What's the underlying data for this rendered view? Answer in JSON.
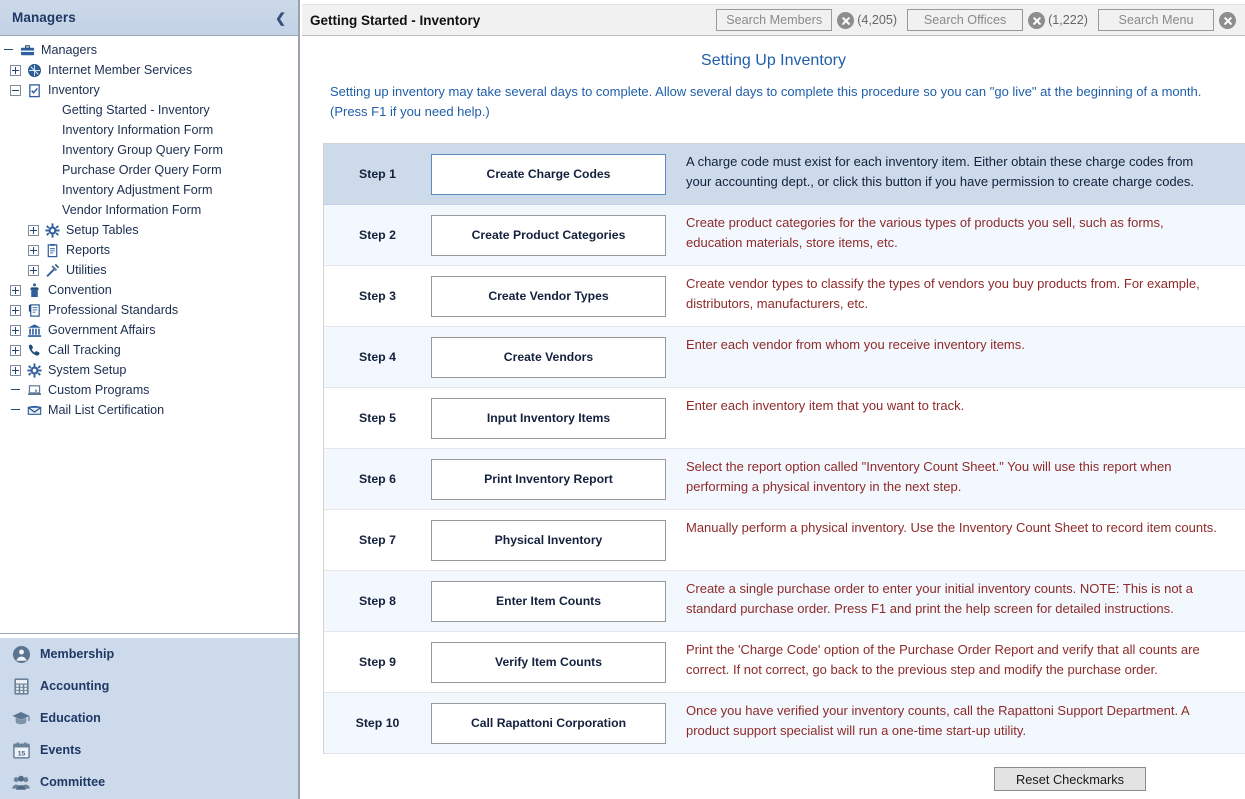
{
  "sidebar": {
    "header_title": "Managers",
    "collapse_icon": "chevron-left-icon",
    "tree": [
      {
        "label": "Managers",
        "icon": "briefcase-icon",
        "level": 0,
        "expander": "none"
      },
      {
        "label": "Internet Member Services",
        "icon": "globe-network-icon",
        "level": 1,
        "expander": "plus"
      },
      {
        "label": "Inventory",
        "icon": "clipboard-check-icon",
        "level": 1,
        "expander": "minus"
      },
      {
        "label": "Getting Started - Inventory",
        "icon": "",
        "level": 3,
        "expander": "none"
      },
      {
        "label": "Inventory Information Form",
        "icon": "",
        "level": 3,
        "expander": "none"
      },
      {
        "label": "Inventory Group Query Form",
        "icon": "",
        "level": 3,
        "expander": "none"
      },
      {
        "label": "Purchase Order Query Form",
        "icon": "",
        "level": 3,
        "expander": "none"
      },
      {
        "label": "Inventory Adjustment Form",
        "icon": "",
        "level": 3,
        "expander": "none"
      },
      {
        "label": "Vendor Information Form",
        "icon": "",
        "level": 3,
        "expander": "none"
      },
      {
        "label": "Setup Tables",
        "icon": "gear-icon",
        "level": 2,
        "expander": "plus"
      },
      {
        "label": "Reports",
        "icon": "report-clipboard-icon",
        "level": 2,
        "expander": "plus"
      },
      {
        "label": "Utilities",
        "icon": "tools-icon",
        "level": 2,
        "expander": "plus"
      },
      {
        "label": "Convention",
        "icon": "podium-icon",
        "level": 1,
        "expander": "plus"
      },
      {
        "label": "Professional Standards",
        "icon": "certificate-icon",
        "level": 1,
        "expander": "plus"
      },
      {
        "label": "Government Affairs",
        "icon": "bank-icon",
        "level": 1,
        "expander": "plus"
      },
      {
        "label": "Call Tracking",
        "icon": "phone-icon",
        "level": 1,
        "expander": "plus"
      },
      {
        "label": "System Setup",
        "icon": "gear-icon",
        "level": 1,
        "expander": "plus"
      },
      {
        "label": "Custom Programs",
        "icon": "laptop-icon",
        "level": 1,
        "expander": "none"
      },
      {
        "label": "Mail List Certification",
        "icon": "envelope-icon",
        "level": 1,
        "expander": "none"
      }
    ],
    "nav_items": [
      {
        "label": "Membership",
        "icon": "person-circle-icon"
      },
      {
        "label": "Accounting",
        "icon": "calculator-icon"
      },
      {
        "label": "Education",
        "icon": "graduation-cap-icon"
      },
      {
        "label": "Events",
        "icon": "calendar-icon"
      },
      {
        "label": "Committee",
        "icon": "people-group-icon"
      }
    ]
  },
  "topbar": {
    "page_title": "Getting Started - Inventory",
    "searches": [
      {
        "placeholder": "Search Members",
        "value": "",
        "count": "(4,205)",
        "clear_icon": "clear-circle-icon"
      },
      {
        "placeholder": "Search Offices",
        "value": "",
        "count": "(1,222)",
        "clear_icon": "clear-circle-icon"
      },
      {
        "placeholder": "Search Menu",
        "value": "",
        "count": "",
        "clear_icon": "clear-circle-icon"
      }
    ]
  },
  "content": {
    "heading": "Setting Up Inventory",
    "intro": "Setting up inventory may take several days to complete. Allow several days to complete this procedure so you can \"go live\" at the beginning of a month. (Press F1 if you need help.)",
    "steps": [
      {
        "step": "Step 1",
        "button": "Create Charge Codes",
        "description": "A charge code must exist for each inventory item. Either obtain these charge codes from your accounting dept., or click this button if you have permission to create charge codes.",
        "state": "active"
      },
      {
        "step": "Step 2",
        "button": "Create Product Categories",
        "description": "Create product categories for the various types of products you sell, such as forms, education materials, store items, etc.",
        "state": "shade"
      },
      {
        "step": "Step 3",
        "button": "Create Vendor Types",
        "description": "Create vendor types to classify the types of vendors you buy products from. For example, distributors, manufacturers, etc.",
        "state": "plain"
      },
      {
        "step": "Step 4",
        "button": "Create Vendors",
        "description": "Enter each vendor from whom you receive inventory items.",
        "state": "shade"
      },
      {
        "step": "Step 5",
        "button": "Input Inventory Items",
        "description": "Enter each inventory item that you want to track.",
        "state": "plain"
      },
      {
        "step": "Step 6",
        "button": "Print Inventory Report",
        "description": "Select the report option called \"Inventory Count Sheet.\"  You will use this report when performing a physical inventory in the next step.",
        "state": "shade"
      },
      {
        "step": "Step 7",
        "button": "Physical Inventory",
        "description": "Manually perform a physical inventory. Use the Inventory Count Sheet to record item counts.",
        "state": "plain"
      },
      {
        "step": "Step 8",
        "button": "Enter Item Counts",
        "description": "Create a single purchase order to enter your initial inventory counts. NOTE: This is not a standard purchase order.  Press F1 and print the help screen for detailed instructions.",
        "state": "shade"
      },
      {
        "step": "Step 9",
        "button": "Verify Item Counts",
        "description": "Print the 'Charge Code' option of the Purchase Order Report and verify that all counts are correct.  If not correct, go back to the previous step and modify the purchase order.",
        "state": "plain"
      },
      {
        "step": "Step 10",
        "button": "Call Rapattoni Corporation",
        "description": "Once you have verified your inventory counts, call the Rapattoni Support Department. A product support specialist will run a one-time start-up utility.",
        "state": "shade"
      }
    ],
    "reset_button": "Reset Checkmarks"
  },
  "colors": {
    "accent_blue": "#1f5fa9",
    "sidebar_blue": "#ccdaeb",
    "desc_red": "#8e2a2a",
    "active_row": "#ccdaea",
    "shade_row": "#f2f8fd"
  }
}
